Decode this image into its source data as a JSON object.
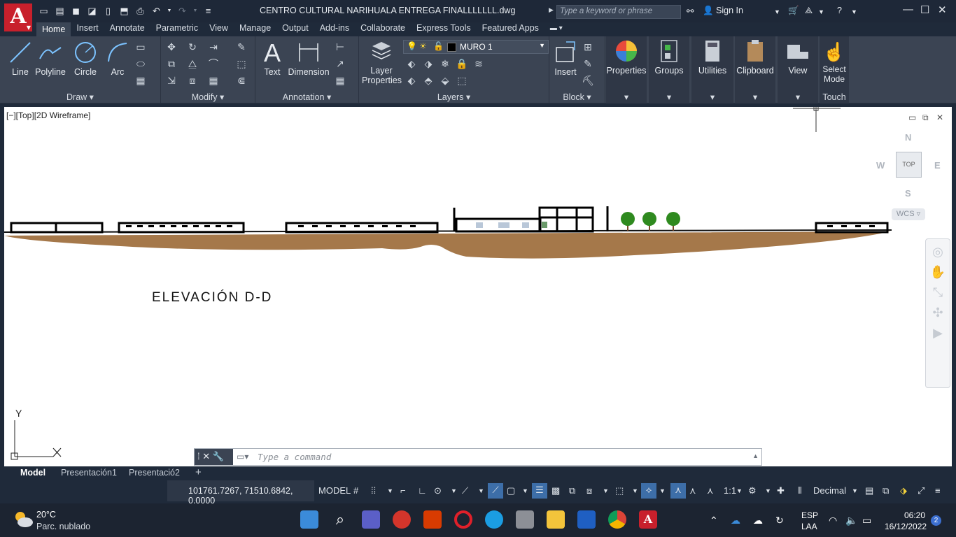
{
  "window": {
    "doc_title": "CENTRO CULTURAL NARIHUALA ENTREGA FINALLLLLLL.dwg",
    "search_placeholder": "Type a keyword or phrase",
    "sign_in": "Sign In",
    "app_logo": "A"
  },
  "ribbon_tabs": [
    "Home",
    "Insert",
    "Annotate",
    "Parametric",
    "View",
    "Manage",
    "Output",
    "Add-ins",
    "Collaborate",
    "Express Tools",
    "Featured Apps"
  ],
  "draw_panel": {
    "title": "Draw",
    "tools": [
      "Line",
      "Polyline",
      "Circle",
      "Arc"
    ]
  },
  "modify_panel": {
    "title": "Modify"
  },
  "annotation_panel": {
    "title": "Annotation",
    "tools": [
      "Text",
      "Dimension"
    ]
  },
  "layers_panel": {
    "title": "Layers",
    "layer_props": "Layer",
    "layer_props2": "Properties",
    "current_layer": "MURO 1"
  },
  "block_panel": {
    "title": "Block",
    "insert": "Insert"
  },
  "right_tools": {
    "properties": "Properties",
    "groups": "Groups",
    "utilities": "Utilities",
    "clipboard": "Clipboard",
    "view": "View",
    "select_mode1": "Select",
    "select_mode2": "Mode",
    "touch": "Touch"
  },
  "viewport": {
    "label": "[−][Top][2D Wireframe]",
    "elevation_title": "ELEVACIÓN  D-D",
    "viewcube_top": "TOP",
    "compass": {
      "n": "N",
      "s": "S",
      "e": "E",
      "w": "W"
    },
    "wcs": "WCS ▿",
    "ucs_y": "Y"
  },
  "command": {
    "placeholder": "Type a command"
  },
  "layout_tabs": [
    "Model",
    "Presentación1",
    "Presentació2"
  ],
  "status": {
    "coords": "101761.7267, 71510.6842, 0.0000",
    "model": "MODEL",
    "scale": "1:1",
    "units": "Decimal"
  },
  "taskbar": {
    "temp": "20°C",
    "weather": "Parc. nublado",
    "lang1": "ESP",
    "lang2": "LAA",
    "time": "06:20",
    "date": "16/12/2022",
    "notifications": "2"
  },
  "colors": {
    "autocad_red": "#c8202c",
    "ground_brown": "#a5784a",
    "tree_green": "#2f8a1f",
    "ribbon_bg": "#3b4453"
  }
}
